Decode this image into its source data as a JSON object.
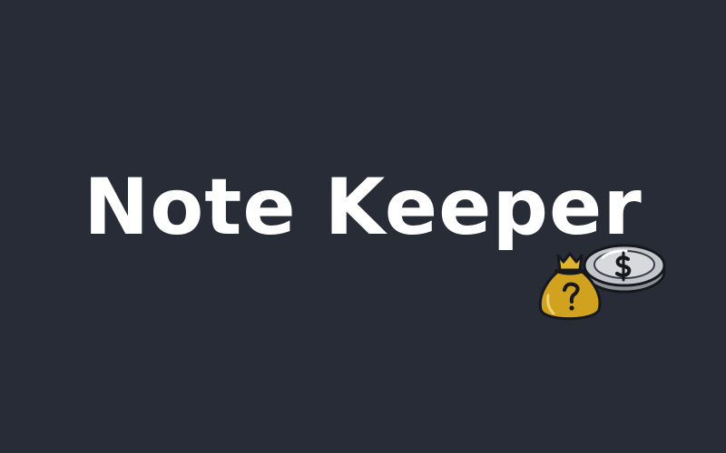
{
  "app": {
    "title": "Note Keeper"
  },
  "icons": {
    "coin": "coin-icon",
    "money_bag": "money-bag-icon"
  },
  "colors": {
    "background": "#282c37",
    "title_text": "#ffffff",
    "bag_fill": "#d0a21f",
    "coin_fill": "#c3c6cb"
  }
}
